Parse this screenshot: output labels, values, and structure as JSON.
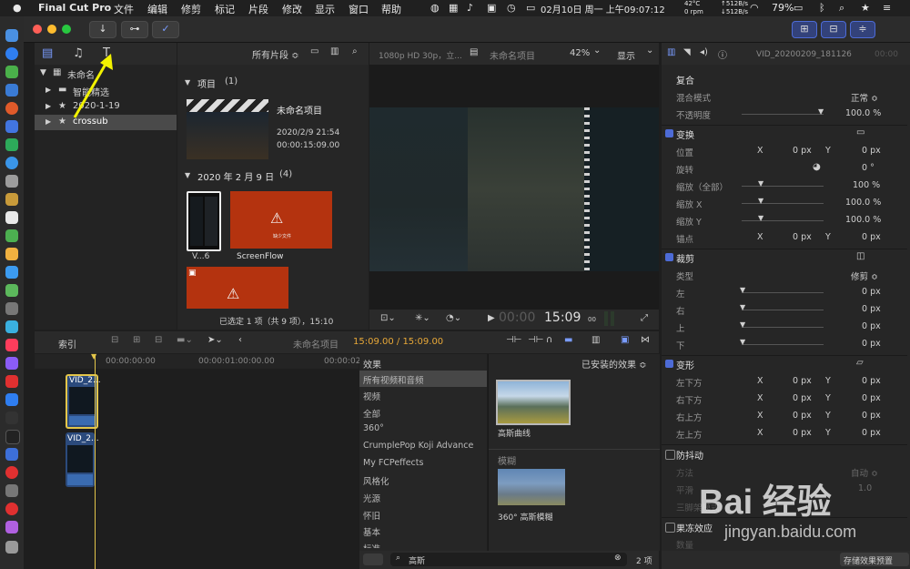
{
  "menubar": {
    "apple": "",
    "app": "Final Cut Pro",
    "items": [
      "文件",
      "编辑",
      "修剪",
      "标记",
      "片段",
      "修改",
      "显示",
      "窗口",
      "帮助"
    ],
    "cpu_temp": "42°C",
    "cpu_fan": "0 rpm",
    "net_up": "↑512B/s",
    "net_down": "↓512B/s",
    "datetime": "02月10日 周一 上午09:07:12",
    "battery": "79%"
  },
  "toolbar": {
    "import_icon": "↓",
    "key_icon": "⊶",
    "check_icon": "✓"
  },
  "library": {
    "root": "未命名",
    "items": [
      "智能精选",
      "2020-1-19",
      "crossub"
    ]
  },
  "browser": {
    "filter": "所有片段 ≎",
    "section_projects": "项目",
    "projects_count": "(1)",
    "project_name": "未命名项目",
    "project_date": "2020/2/9 21:54",
    "project_duration": "00:00:15:09.00",
    "section_date": "2020 年 2 月 9 日",
    "date_count": "(4)",
    "clip1_label": "V...6",
    "clip2_label": "ScreenFlow",
    "missing_file": "缺少文件",
    "status": "已选定 1 项（共 9 项），15:10"
  },
  "viewer": {
    "format": "1080p HD 30p，立...",
    "project": "未命名项目",
    "zoom": "42%",
    "zoom_chevron": "⌄",
    "display": "显示",
    "display_chevron": "⌄",
    "timecode_dim": "00:00",
    "timecode": "15:09",
    "timecode_frames": "00"
  },
  "timeline": {
    "index_label": "索引",
    "project": "未命名项目",
    "timecode": "15:09.00 / 15:09.00",
    "ruler": [
      "00:00:00:00",
      "00:00:01:00:00.00",
      "00:00:02:00"
    ],
    "clip1": "VID_2...",
    "clip2": "VID_2..."
  },
  "effects": {
    "title": "效果",
    "installed": "已安装的效果 ≎",
    "categories": [
      "所有视频和音频",
      "视频",
      "全部",
      "360°",
      "CrumplePop Koji Advance",
      "My FCPeffects",
      "风格化",
      "光源",
      "怀旧",
      "基本",
      "标准"
    ],
    "selected_index": 0,
    "result1": "高斯曲线",
    "group2": "模糊",
    "result2": "360° 高斯模糊",
    "search_value": "高斯",
    "count": "2 项"
  },
  "inspector": {
    "clip_name": "VID_20200209_181126",
    "clip_tc": "00:00",
    "composite": "复合",
    "blend_mode_label": "混合模式",
    "blend_mode_value": "正常 ≎",
    "opacity_label": "不透明度",
    "opacity_value": "100.0 %",
    "transform": "变换",
    "position": "位置",
    "x": "X",
    "y": "Y",
    "zero_px": "0 px",
    "rotation": "旋转",
    "rotation_value": "0 °",
    "scale_all": "缩放（全部）",
    "scale_all_value": "100 %",
    "scale_x": "缩放 X",
    "scale_x_value": "100.0 %",
    "scale_y": "缩放 Y",
    "scale_y_value": "100.0 %",
    "anchor": "锚点",
    "crop": "裁剪",
    "crop_type": "类型",
    "crop_type_value": "修剪 ≎",
    "left": "左",
    "right": "右",
    "top": "上",
    "bottom": "下",
    "distort": "变形",
    "bottom_left": "左下方",
    "bottom_right": "右下方",
    "top_right": "右上方",
    "top_left": "左上方",
    "stabilize": "防抖动",
    "method": "方法",
    "method_value": "自动 ≎",
    "smooth": "平滑",
    "smooth_value": "1.0",
    "tripod": "三脚架模式",
    "rolling": "果冻效应",
    "amount": "数量",
    "save_preset": "存储效果预置"
  },
  "watermark": {
    "text": "Bai 经验",
    "url": "jingyan.baidu.com"
  },
  "colors": {
    "accent": "#4d6bd6",
    "playhead": "#e4c64a",
    "clip": "#2b4a7c",
    "missing": "#b4330f",
    "arrow": "#f2f200"
  }
}
